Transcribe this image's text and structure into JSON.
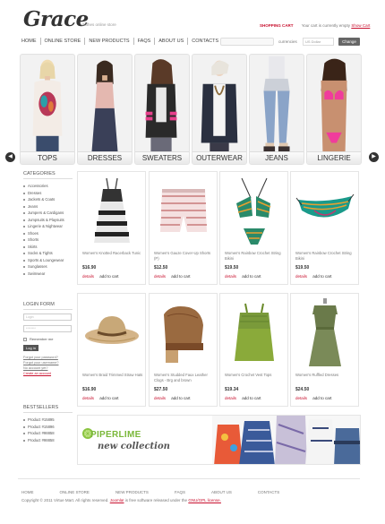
{
  "header": {
    "logo": "Grace",
    "tagline": "clothes online store",
    "cart_title": "SHOPPING CART",
    "cart_text": "Your cart is currently empty",
    "cart_link": "Show Cart"
  },
  "nav": [
    "HOME",
    "ONLINE STORE",
    "NEW PRODUCTS",
    "FAQS",
    "ABOUT US",
    "CONTACTS"
  ],
  "currency": {
    "label": "currencies",
    "selected": "US Dollar",
    "button": "Change"
  },
  "carousel": {
    "items": [
      "TOPS",
      "DRESSES",
      "SWEATERS",
      "OUTERWEAR",
      "JEANS",
      "LINGERIE"
    ],
    "prev_icon": "chevron-left-icon",
    "next_icon": "chevron-right-icon"
  },
  "sidebar": {
    "categories_title": "CATEGORIES",
    "categories": [
      "Accessories",
      "Dresses",
      "Jackets & Coats",
      "Jeans",
      "Jumpers & Cardigans",
      "Jumpsuits & Playsuits",
      "Lingerie & Nightwear",
      "Shoes",
      "Shorts",
      "Skirts",
      "Socks & Tights",
      "Sports & Loungewear",
      "Sunglasses",
      "Swimwear"
    ],
    "login_title": "LOGIN FORM",
    "login_placeholder": "Login",
    "password_placeholder": "********",
    "remember": "Remember me",
    "login_button": "Log in",
    "forgot_password": "Forgot your password?",
    "forgot_username": "Forgot your username?",
    "no_account": "No account yet?",
    "create_account": "Create an account",
    "best_title": "BESTSELLERS",
    "bestsellers": [
      "Product #15895",
      "Product #15896",
      "Product #98858",
      "Product #98858"
    ]
  },
  "products": [
    {
      "name": "Women's Knotted Racerback Tunic",
      "price": "$16.90",
      "details": "details",
      "add": "add to cart"
    },
    {
      "name": "Women's Gauze Cover-Up Shorts (P)",
      "price": "$12.50",
      "details": "details",
      "add": "add to cart"
    },
    {
      "name": "Women's Rainbow Crochet String Bikini",
      "price": "$19.50",
      "details": "details",
      "add": "add to cart"
    },
    {
      "name": "Women's Rainbow Crochet String Bikini",
      "price": "$19.50",
      "details": "details",
      "add": "add to cart"
    },
    {
      "name": "Women's Braid Trimmed Straw Hats",
      "price": "$16.90",
      "details": "details",
      "add": "add to cart"
    },
    {
      "name": "Women's Studded Faux Leather Clogs - Brg and brown",
      "price": "$27.50",
      "details": "details",
      "add": "add to cart"
    },
    {
      "name": "Women's Crochet Vest Tops",
      "price": "$19.34",
      "details": "details",
      "add": "add to cart"
    },
    {
      "name": "Women's Ruffled Dresses",
      "price": "$24.50",
      "details": "details",
      "add": "add to cart"
    }
  ],
  "banner": {
    "brand": "PIPERLIME",
    "tagline": "new collection"
  },
  "footer": {
    "nav": [
      "HOME",
      "ONLINE STORE",
      "NEW PRODUCTS",
      "FAQS",
      "ABOUT US",
      "CONTACTS"
    ],
    "copyright_pre": "Copyright © 2011 Virtue Mart. All rights reserved.",
    "copyright_link1": "Joomla!",
    "copyright_mid": "is free software released under the",
    "copyright_link2": "GNU/GPL license."
  }
}
